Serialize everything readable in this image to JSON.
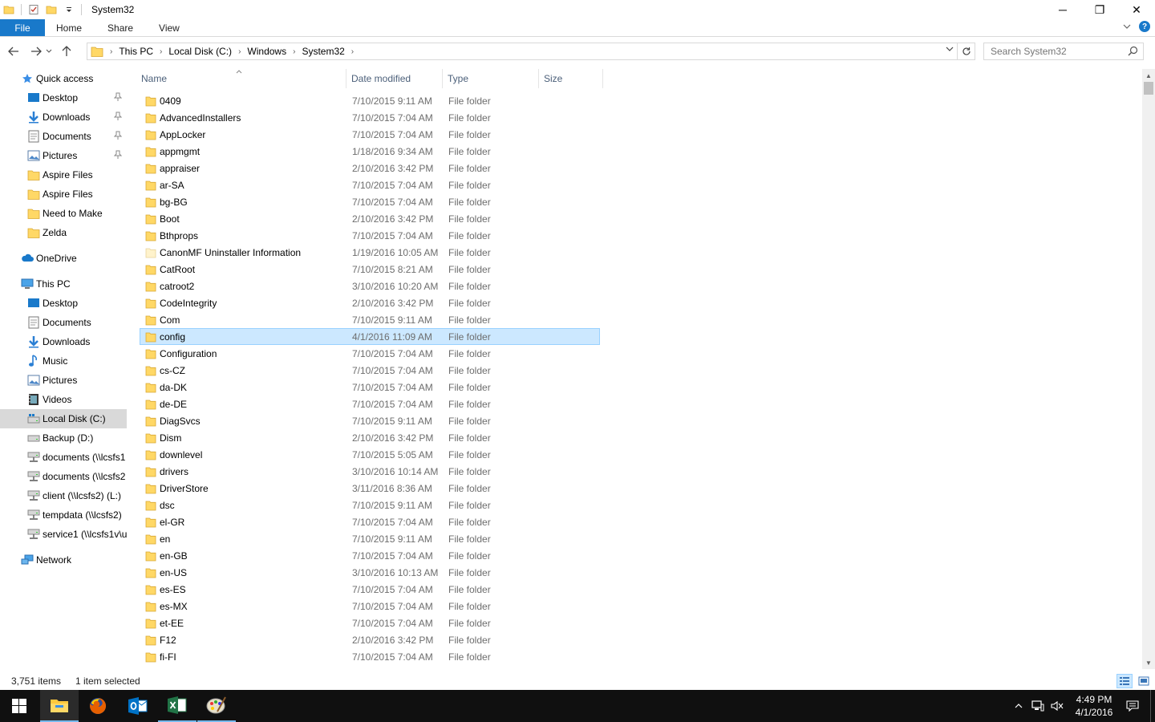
{
  "window": {
    "title": "System32",
    "controls": {
      "minimize": "─",
      "maximize": "❐",
      "close": "✕"
    }
  },
  "ribbon": {
    "tabs": [
      {
        "label": "File"
      },
      {
        "label": "Home"
      },
      {
        "label": "Share"
      },
      {
        "label": "View"
      }
    ]
  },
  "address": {
    "crumbs": [
      "This PC",
      "Local Disk (C:)",
      "Windows",
      "System32"
    ],
    "search_placeholder": "Search System32"
  },
  "nav": {
    "quick_access": "Quick access",
    "quick_items": [
      {
        "label": "Desktop",
        "icon": "desktop-icon",
        "pinned": true
      },
      {
        "label": "Downloads",
        "icon": "downloads-icon",
        "pinned": true
      },
      {
        "label": "Documents",
        "icon": "documents-icon",
        "pinned": true
      },
      {
        "label": "Pictures",
        "icon": "pictures-icon",
        "pinned": true
      },
      {
        "label": "Aspire Files",
        "icon": "folder-icon",
        "pinned": false
      },
      {
        "label": "Aspire Files",
        "icon": "folder-icon",
        "pinned": false
      },
      {
        "label": "Need to Make",
        "icon": "folder-icon",
        "pinned": false
      },
      {
        "label": "Zelda",
        "icon": "folder-icon",
        "pinned": false
      }
    ],
    "onedrive": "OneDrive",
    "this_pc": "This PC",
    "pc_items": [
      {
        "label": "Desktop",
        "icon": "desktop-icon"
      },
      {
        "label": "Documents",
        "icon": "documents-icon"
      },
      {
        "label": "Downloads",
        "icon": "downloads-icon"
      },
      {
        "label": "Music",
        "icon": "music-icon"
      },
      {
        "label": "Pictures",
        "icon": "pictures-icon"
      },
      {
        "label": "Videos",
        "icon": "videos-icon"
      },
      {
        "label": "Local Disk (C:)",
        "icon": "local-disk-icon",
        "selected": true
      },
      {
        "label": "Backup (D:)",
        "icon": "drive-icon"
      },
      {
        "label": "documents (\\\\lcsfs1",
        "icon": "network-drive-icon"
      },
      {
        "label": "documents (\\\\lcsfs2",
        "icon": "network-drive-icon"
      },
      {
        "label": "client (\\\\lcsfs2) (L:)",
        "icon": "network-drive-icon"
      },
      {
        "label": "tempdata (\\\\lcsfs2)",
        "icon": "network-drive-icon"
      },
      {
        "label": "service1 (\\\\lcsfs1v\\u",
        "icon": "network-drive-icon"
      }
    ],
    "network": "Network"
  },
  "columns": {
    "name": "Name",
    "date": "Date modified",
    "type": "Type",
    "size": "Size"
  },
  "files": [
    {
      "name": "0409",
      "date": "7/10/2015 9:11 AM",
      "type": "File folder"
    },
    {
      "name": "AdvancedInstallers",
      "date": "7/10/2015 7:04 AM",
      "type": "File folder"
    },
    {
      "name": "AppLocker",
      "date": "7/10/2015 7:04 AM",
      "type": "File folder"
    },
    {
      "name": "appmgmt",
      "date": "1/18/2016 9:34 AM",
      "type": "File folder"
    },
    {
      "name": "appraiser",
      "date": "2/10/2016 3:42 PM",
      "type": "File folder"
    },
    {
      "name": "ar-SA",
      "date": "7/10/2015 7:04 AM",
      "type": "File folder"
    },
    {
      "name": "bg-BG",
      "date": "7/10/2015 7:04 AM",
      "type": "File folder"
    },
    {
      "name": "Boot",
      "date": "2/10/2016 3:42 PM",
      "type": "File folder"
    },
    {
      "name": "Bthprops",
      "date": "7/10/2015 7:04 AM",
      "type": "File folder"
    },
    {
      "name": "CanonMF Uninstaller Information",
      "date": "1/19/2016 10:05 AM",
      "type": "File folder",
      "faded": true
    },
    {
      "name": "CatRoot",
      "date": "7/10/2015 8:21 AM",
      "type": "File folder"
    },
    {
      "name": "catroot2",
      "date": "3/10/2016 10:20 AM",
      "type": "File folder"
    },
    {
      "name": "CodeIntegrity",
      "date": "2/10/2016 3:42 PM",
      "type": "File folder"
    },
    {
      "name": "Com",
      "date": "7/10/2015 9:11 AM",
      "type": "File folder"
    },
    {
      "name": "config",
      "date": "4/1/2016 11:09 AM",
      "type": "File folder",
      "selected": true
    },
    {
      "name": "Configuration",
      "date": "7/10/2015 7:04 AM",
      "type": "File folder"
    },
    {
      "name": "cs-CZ",
      "date": "7/10/2015 7:04 AM",
      "type": "File folder"
    },
    {
      "name": "da-DK",
      "date": "7/10/2015 7:04 AM",
      "type": "File folder"
    },
    {
      "name": "de-DE",
      "date": "7/10/2015 7:04 AM",
      "type": "File folder"
    },
    {
      "name": "DiagSvcs",
      "date": "7/10/2015 9:11 AM",
      "type": "File folder"
    },
    {
      "name": "Dism",
      "date": "2/10/2016 3:42 PM",
      "type": "File folder"
    },
    {
      "name": "downlevel",
      "date": "7/10/2015 5:05 AM",
      "type": "File folder"
    },
    {
      "name": "drivers",
      "date": "3/10/2016 10:14 AM",
      "type": "File folder"
    },
    {
      "name": "DriverStore",
      "date": "3/11/2016 8:36 AM",
      "type": "File folder"
    },
    {
      "name": "dsc",
      "date": "7/10/2015 9:11 AM",
      "type": "File folder"
    },
    {
      "name": "el-GR",
      "date": "7/10/2015 7:04 AM",
      "type": "File folder"
    },
    {
      "name": "en",
      "date": "7/10/2015 9:11 AM",
      "type": "File folder"
    },
    {
      "name": "en-GB",
      "date": "7/10/2015 7:04 AM",
      "type": "File folder"
    },
    {
      "name": "en-US",
      "date": "3/10/2016 10:13 AM",
      "type": "File folder"
    },
    {
      "name": "es-ES",
      "date": "7/10/2015 7:04 AM",
      "type": "File folder"
    },
    {
      "name": "es-MX",
      "date": "7/10/2015 7:04 AM",
      "type": "File folder"
    },
    {
      "name": "et-EE",
      "date": "7/10/2015 7:04 AM",
      "type": "File folder"
    },
    {
      "name": "F12",
      "date": "2/10/2016 3:42 PM",
      "type": "File folder"
    },
    {
      "name": "fi-FI",
      "date": "7/10/2015 7:04 AM",
      "type": "File folder"
    }
  ],
  "status": {
    "items": "3,751 items",
    "selected": "1 item selected"
  },
  "taskbar": {
    "apps": [
      {
        "name": "file-explorer",
        "state": "active"
      },
      {
        "name": "firefox",
        "state": ""
      },
      {
        "name": "outlook",
        "state": ""
      },
      {
        "name": "excel",
        "state": "running"
      },
      {
        "name": "paint",
        "state": "running"
      }
    ],
    "time": "4:49 PM",
    "date": "4/1/2016"
  },
  "colors": {
    "accent": "#1979ca",
    "selection": "#cce8ff",
    "selection_border": "#99d1ff",
    "folder": "#ffd866",
    "taskbar": "#101010"
  }
}
